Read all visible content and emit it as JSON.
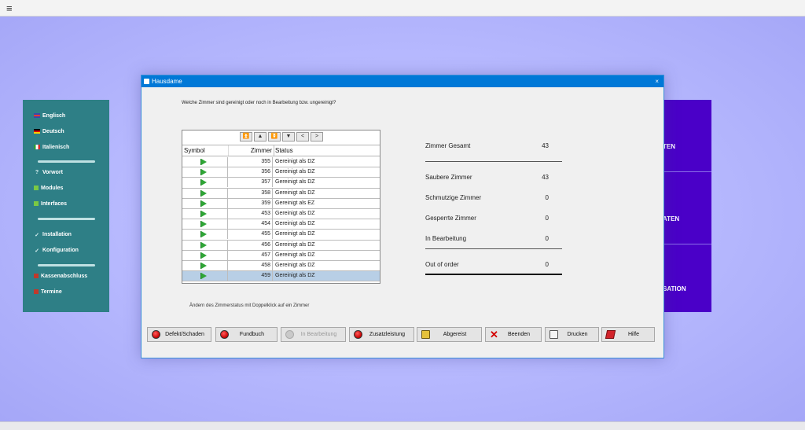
{
  "topbar": {
    "menu_icon": "≡"
  },
  "left_menu": {
    "items": [
      {
        "label": "Englisch",
        "icon": "flag-uk-icon"
      },
      {
        "label": "Deutsch",
        "icon": "flag-de-icon"
      },
      {
        "label": "Italienisch",
        "icon": "flag-it-icon"
      },
      {
        "label": "Vorwort",
        "icon": "question-icon"
      },
      {
        "label": "Modules",
        "icon": "square-icon"
      },
      {
        "label": "Interfaces",
        "icon": "square-icon"
      },
      {
        "label": "Installation",
        "icon": "check-icon"
      },
      {
        "label": "Konfiguration",
        "icon": "check-icon"
      },
      {
        "label": "Kassenabschluss",
        "icon": "calendar-icon"
      },
      {
        "label": "Termine",
        "icon": "calendar-icon"
      }
    ]
  },
  "right_panel": {
    "items": [
      {
        "label": "TEN"
      },
      {
        "label": "ATEN"
      },
      {
        "label": "SATION"
      }
    ]
  },
  "dialog": {
    "title": "Hausdame",
    "close": "×",
    "question": "Welche Zimmer sind gereinigt oder noch in Bearbeitung bzw. ungereinigt?",
    "hint": "Ändern des Zimmerstatus mit Doppelklick auf ein Zimmer",
    "nav_buttons": [
      "⏫",
      "▲",
      "⏬",
      "▼",
      "<",
      ">"
    ],
    "table": {
      "headers": {
        "symbol": "Symbol",
        "zimmer": "Zimmer",
        "status": "Status"
      },
      "rows": [
        {
          "zimmer": "355",
          "status": "Gereinigt als DZ"
        },
        {
          "zimmer": "356",
          "status": "Gereinigt als DZ"
        },
        {
          "zimmer": "357",
          "status": "Gereinigt als DZ"
        },
        {
          "zimmer": "358",
          "status": "Gereinigt als DZ"
        },
        {
          "zimmer": "359",
          "status": "Gereinigt als EZ"
        },
        {
          "zimmer": "453",
          "status": "Gereinigt als DZ"
        },
        {
          "zimmer": "454",
          "status": "Gereinigt als DZ"
        },
        {
          "zimmer": "455",
          "status": "Gereinigt als DZ"
        },
        {
          "zimmer": "456",
          "status": "Gereinigt als DZ"
        },
        {
          "zimmer": "457",
          "status": "Gereinigt als DZ"
        },
        {
          "zimmer": "458",
          "status": "Gereinigt als DZ"
        },
        {
          "zimmer": "459",
          "status": "Gereinigt als DZ",
          "selected": true
        }
      ]
    },
    "stats": [
      {
        "label": "Zimmer Gesamt",
        "value": "43"
      },
      {
        "label": "Saubere Zimmer",
        "value": "43"
      },
      {
        "label": "Schmutzige Zimmer",
        "value": "0"
      },
      {
        "label": "Gesperrte Zimmer",
        "value": "0"
      },
      {
        "label": "In Bearbeitung",
        "value": "0"
      },
      {
        "label": "Out of order",
        "value": "0"
      }
    ],
    "buttons": {
      "defekt": "Defekt/Schaden",
      "fundbuch": "Fundbuch",
      "in_bearbeitung": "In Bearbeitung",
      "zusatzleistung": "Zusatzleistung",
      "abgereist": "Abgereist",
      "beenden": "Beenden",
      "drucken": "Drucken",
      "hilfe": "Hilfe"
    }
  }
}
